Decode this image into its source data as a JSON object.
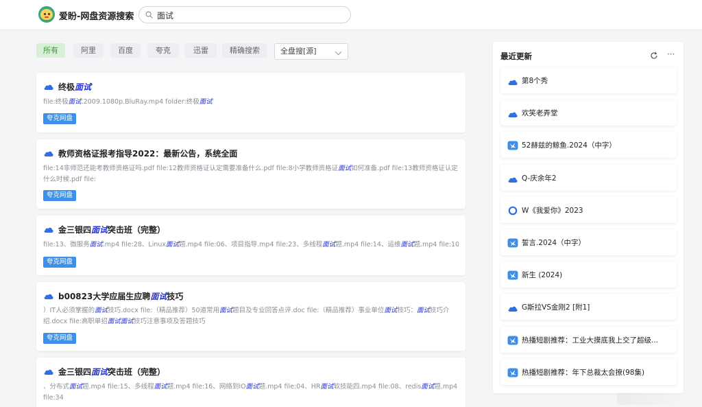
{
  "header": {
    "site_title": "爱盼-网盘资源搜索",
    "search_value": "面试"
  },
  "filters": {
    "tabs": [
      {
        "label": "所有",
        "active": true
      },
      {
        "label": "阿里",
        "active": false
      },
      {
        "label": "百度",
        "active": false
      },
      {
        "label": "夸克",
        "active": false
      },
      {
        "label": "迅雷",
        "active": false
      },
      {
        "label": "精确搜索",
        "active": false
      }
    ],
    "source_select": "全盘搜[源]"
  },
  "results": [
    {
      "title_before": "终极",
      "title_highlight": "面试",
      "title_after": "",
      "desc_segments": [
        "file:终极",
        "面试",
        ".2009.1080p.BluRay.mp4 folder:终极",
        "面试",
        ""
      ],
      "tag": "夸克网盘"
    },
    {
      "title_before": "教师资格证报考指导2022：最新公告，系统全面",
      "title_highlight": "",
      "title_after": "",
      "desc_segments": [
        "file:14非师范还能考教师资格证吗.pdf file:12教师资格证认定需要准备什么.pdf file:8小学教师资格证",
        "面试",
        "如何准备.pdf file:13教师资格证认定什么时候.pdf file:"
      ],
      "tag": "夸克网盘"
    },
    {
      "title_before": "金三银四",
      "title_highlight": "面试",
      "title_after": "突击班（完整）",
      "desc_segments": [
        "file:13、微服务",
        "面试",
        ".mp4 file:28、Linux",
        "面试",
        "题.mp4 file:06、项目指导.mp4 file:23、多线程",
        "面试",
        "题.mp4 file:14、运维",
        "面试",
        "题.mp4 file:10、"
      ],
      "tag": "夸克网盘"
    },
    {
      "title_before": "b00823大学应届生应聘",
      "title_highlight": "面试",
      "title_after": "技巧",
      "desc_segments": [
        "）IT人必须掌握的",
        "面试",
        "技巧.docx file:（精品推荐）50道常用",
        "面试",
        "题目及专业回答点评.doc file:（精品推荐）事业单位",
        "面试",
        "技巧：",
        "面试",
        "技巧介绍.docx file:高职单招",
        "面试",
        "",
        "面试",
        "技巧注意事项及答题技巧"
      ],
      "tag": "夸克网盘"
    },
    {
      "title_before": "金三银四",
      "title_highlight": "面试",
      "title_after": "突击班（完整）",
      "desc_segments": [
        "、分布式",
        "面试",
        "题.mp4 file:15、多线程",
        "面试",
        "题.mp4 file:16、网络到IO",
        "面试",
        "题.mp4 file:04、HR",
        "面试",
        "软技能四.mp4 file:08、redis",
        "面试",
        "题.mp4 file:34"
      ],
      "tag": ""
    }
  ],
  "sidebar": {
    "title": "最近更新",
    "items": [
      {
        "label": "第8个秀",
        "icon": "quark-cloud-icon"
      },
      {
        "label": "欢笑老弄堂",
        "icon": "quark-cloud-icon"
      },
      {
        "label": "52赫兹的鲸鱼.2024（中字）",
        "icon": "xunlei-bird-icon"
      },
      {
        "label": "Q-庆余年2",
        "icon": "quark-cloud-icon"
      },
      {
        "label": "W《我爱你》2023",
        "icon": "quark-ring-icon"
      },
      {
        "label": "誓言.2024（中字）",
        "icon": "xunlei-bird-icon"
      },
      {
        "label": "新生 (2024)",
        "icon": "xunlei-bird-icon"
      },
      {
        "label": "G斯拉VS金刚2 [附1]",
        "icon": "quark-cloud-icon"
      },
      {
        "label": "热播短剧推荐：工业大摸底我上交了超级...",
        "icon": "xunlei-bird-icon"
      },
      {
        "label": "热播短剧推荐：年下总裁太会撩(98集)",
        "icon": "xunlei-bird-icon"
      }
    ]
  },
  "colors": {
    "accent_blue": "#3d8fe8",
    "highlight": "#2431d8",
    "active_tab_bg": "#d8f0d6",
    "active_tab_text": "#3c9a3a"
  }
}
